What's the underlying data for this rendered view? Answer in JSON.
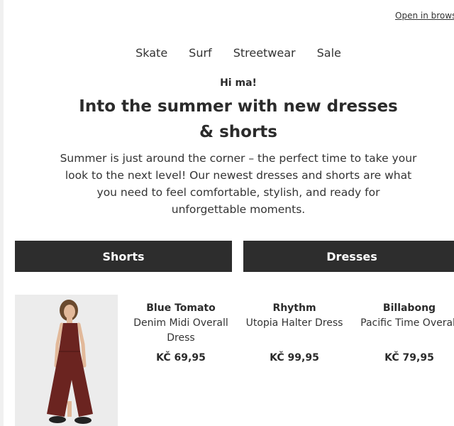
{
  "header": {
    "open_in_browser": "Open in browser"
  },
  "nav": {
    "items": [
      "Skate",
      "Surf",
      "Streetwear",
      "Sale"
    ]
  },
  "hero": {
    "greeting": "Hi ma!",
    "headline": "Into the summer with new dresses & shorts",
    "intro": "Summer is just around the corner – the perfect time to take your look to the next level! Our newest dresses and shorts are what you need to feel comfortable, stylish, and ready for unforgettable moments."
  },
  "categories": [
    "Shorts",
    "Dresses"
  ],
  "products": [
    {
      "brand": "Blue Tomato",
      "name": "Denim Midi Overall Dress",
      "price": "KČ 69,95"
    },
    {
      "brand": "Rhythm",
      "name": "Utopia Halter Dress",
      "price": "KČ 99,95"
    },
    {
      "brand": "Billabong",
      "name": "Pacific Time Overall",
      "price": "KČ 79,95"
    }
  ],
  "colors": {
    "button_bg": "#2d2d2d",
    "dress": "#6b2420"
  }
}
